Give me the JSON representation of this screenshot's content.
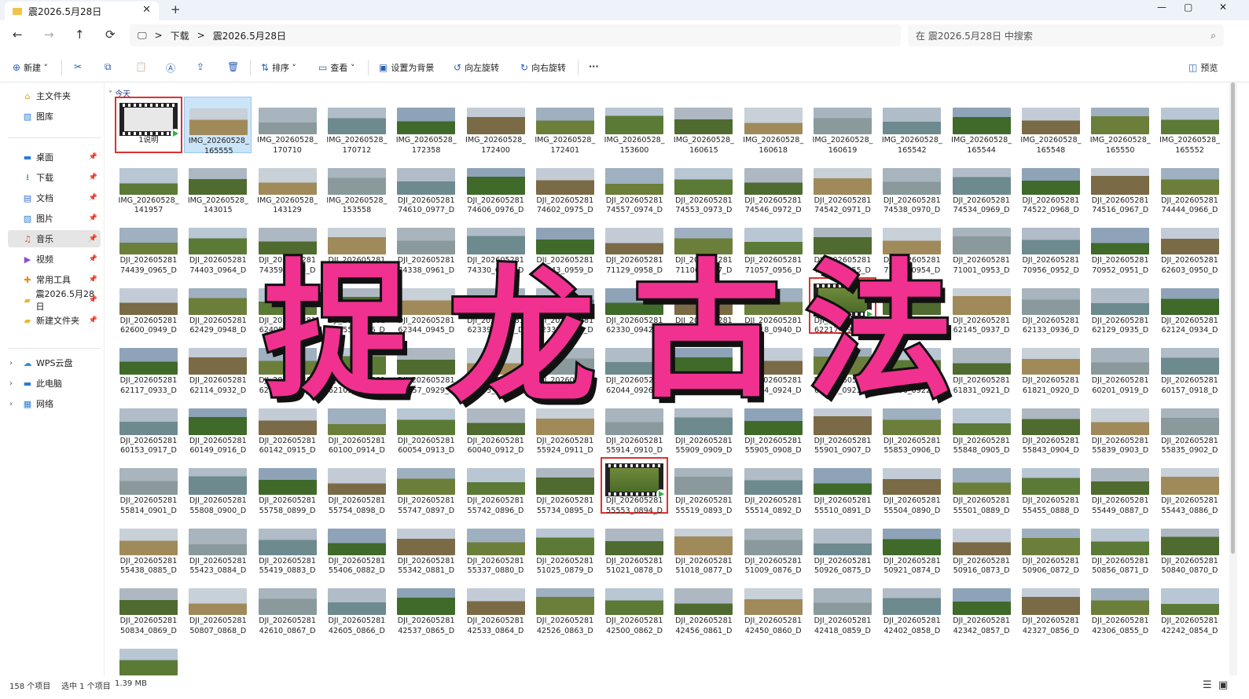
{
  "tab": {
    "title": "震2026.5月28日",
    "close": "✕",
    "new": "+"
  },
  "window": {
    "min": "—",
    "max": "▢",
    "close": "✕"
  },
  "nav": {
    "back": "←",
    "forward": "→",
    "up": "↑",
    "refresh": "⟳",
    "monitor": "🖵",
    "crumb_sep": ">",
    "crumb1": "下载",
    "crumb2": "震2026.5月28日"
  },
  "search": {
    "placeholder": "在 震2026.5月28日 中搜索",
    "icon": "⌕"
  },
  "toolbar": {
    "new": "新建",
    "sort": "排序",
    "view": "查看",
    "setbg": "设置为背景",
    "rotleft": "向左旋转",
    "rotright": "向右旋转",
    "more": "···",
    "preview": "预览",
    "cut": "✂",
    "copy": "⧉",
    "paste": "📋",
    "rename": "Ⓐ",
    "share": "⇪",
    "delete": "🗑"
  },
  "sidebar": {
    "home": "主文件夹",
    "gallery": "图库",
    "quick": [
      {
        "label": "桌面",
        "icon": "▬",
        "color": "#2b7cd3"
      },
      {
        "label": "下载",
        "icon": "⭳",
        "color": "#2b9a4a"
      },
      {
        "label": "文档",
        "icon": "▤",
        "color": "#3a6fcf"
      },
      {
        "label": "图片",
        "icon": "▨",
        "color": "#2f7fd6"
      },
      {
        "label": "音乐",
        "icon": "♫",
        "color": "#e4573b"
      },
      {
        "label": "视频",
        "icon": "▶",
        "color": "#8a4fd0"
      },
      {
        "label": "常用工具",
        "icon": "✚",
        "color": "#e08f1f"
      },
      {
        "label": "震2026.5月28日",
        "icon": "▰",
        "color": "#e8b53a"
      },
      {
        "label": "新建文件夹",
        "icon": "▰",
        "color": "#e8b53a"
      }
    ],
    "pin": "📌",
    "wps": "WPS云盘",
    "pc": "此电脑",
    "net": "网络",
    "chev": "›"
  },
  "group_label": "今天",
  "files": [
    "1说明",
    "IMG_20260528_\n165555",
    "IMG_20260528_\n170710",
    "IMG_20260528_\n170712",
    "IMG_20260528_\n172358",
    "IMG_20260528_\n172400",
    "IMG_20260528_\n172401",
    "IMG_20260528_\n153600",
    "IMG_20260528_\n160615",
    "IMG_20260528_\n160618",
    "IMG_20260528_\n160619",
    "IMG_20260528_\n165542",
    "IMG_20260528_\n165544",
    "IMG_20260528_\n165548",
    "IMG_20260528_\n165550",
    "IMG_20260528_\n165552",
    "IMG_20260528_\n141957",
    "IMG_20260528_\n143015",
    "IMG_20260528_\n143129",
    "IMG_20260528_\n153558",
    "DJI_202605281\n74610_0977_D",
    "DJI_202605281\n74606_0976_D",
    "DJI_202605281\n74602_0975_D",
    "DJI_202605281\n74557_0974_D",
    "DJI_202605281\n74553_0973_D",
    "DJI_202605281\n74546_0972_D",
    "DJI_202605281\n74542_0971_D",
    "DJI_202605281\n74538_0970_D",
    "DJI_202605281\n74534_0969_D",
    "DJI_202605281\n74522_0968_D",
    "DJI_202605281\n74516_0967_D",
    "DJI_202605281\n74444_0966_D",
    "DJI_202605281\n74439_0965_D",
    "DJI_202605281\n74403_0964_D",
    "DJI_202605281\n74359_0963_D",
    "DJI_202605281\n74344_0962_D",
    "DJI_202605281\n74338_0961_D",
    "DJI_202605281\n74330_0960_D",
    "DJI_202605281\n71143_0959_D",
    "DJI_202605281\n71129_0958_D",
    "DJI_202605281\n71106_0957_D",
    "DJI_202605281\n71057_0956_D",
    "DJI_202605281\n71036_0955_D",
    "DJI_202605281\n71005_0954_D",
    "DJI_202605281\n71001_0953_D",
    "DJI_202605281\n70956_0952_D",
    "DJI_202605281\n70952_0951_D",
    "DJI_202605281\n62603_0950_D",
    "DJI_202605281\n62600_0949_D",
    "DJI_202605281\n62429_0948_D",
    "DJI_202605281\n62409_0947_D",
    "DJI_202605281\n62355_0946_D",
    "DJI_202605281\n62344_0945_D",
    "DJI_202605281\n62339_0944_D",
    "DJI_202605281\n62335_0943_D",
    "DJI_202605281\n62330_0942_D",
    "DJI_202605281\n62322_0941_D",
    "DJI_202605281\n62318_0940_D",
    "DJI_202605281\n62217_0939_D",
    "DJI_202605281\n62150_0938_D",
    "DJI_202605281\n62145_0937_D",
    "DJI_202605281\n62133_0936_D",
    "DJI_202605281\n62129_0935_D",
    "DJI_202605281\n62124_0934_D",
    "DJI_202605281\n62117_0933_D",
    "DJI_202605281\n62114_0932_D",
    "DJI_202605281\n62110_0931_D",
    "DJI_202605281\n62105_0930_D",
    "DJI_202605281\n62057_0929_D",
    "DJI_202605281\n62053_0928_D",
    "DJI_202605281\n62048_0927_D",
    "DJI_202605281\n62044_0926_D",
    "DJI_202605281\n61908_0925_D",
    "DJI_202605281\n61904_0924_D",
    "DJI_202605281\n61851_0923_D",
    "DJI_202605281\n61836_0922_D",
    "DJI_202605281\n61831_0921_D",
    "DJI_202605281\n61821_0920_D",
    "DJI_202605281\n60201_0919_D",
    "DJI_202605281\n60157_0918_D",
    "DJI_202605281\n60153_0917_D",
    "DJI_202605281\n60149_0916_D",
    "DJI_202605281\n60142_0915_D",
    "DJI_202605281\n60100_0914_D",
    "DJI_202605281\n60054_0913_D",
    "DJI_202605281\n60040_0912_D",
    "DJI_202605281\n55924_0911_D",
    "DJI_202605281\n55914_0910_D",
    "DJI_202605281\n55909_0909_D",
    "DJI_202605281\n55905_0908_D",
    "DJI_202605281\n55901_0907_D",
    "DJI_202605281\n55853_0906_D",
    "DJI_202605281\n55848_0905_D",
    "DJI_202605281\n55843_0904_D",
    "DJI_202605281\n55839_0903_D",
    "DJI_202605281\n55835_0902_D",
    "DJI_202605281\n55814_0901_D",
    "DJI_202605281\n55808_0900_D",
    "DJI_202605281\n55758_0899_D",
    "DJI_202605281\n55754_0898_D",
    "DJI_202605281\n55747_0897_D",
    "DJI_202605281\n55742_0896_D",
    "DJI_202605281\n55734_0895_D",
    "DJI_202605281\n55553_0894_D",
    "DJI_202605281\n55519_0893_D",
    "DJI_202605281\n55514_0892_D",
    "DJI_202605281\n55510_0891_D",
    "DJI_202605281\n55504_0890_D",
    "DJI_202605281\n55501_0889_D",
    "DJI_202605281\n55455_0888_D",
    "DJI_202605281\n55449_0887_D",
    "DJI_202605281\n55443_0886_D",
    "DJI_202605281\n55438_0885_D",
    "DJI_202605281\n55423_0884_D",
    "DJI_202605281\n55419_0883_D",
    "DJI_202605281\n55406_0882_D",
    "DJI_202605281\n55342_0881_D",
    "DJI_202605281\n55337_0880_D",
    "DJI_202605281\n51025_0879_D",
    "DJI_202605281\n51021_0878_D",
    "DJI_202605281\n51018_0877_D",
    "DJI_202605281\n51009_0876_D",
    "DJI_202605281\n50926_0875_D",
    "DJI_202605281\n50921_0874_D",
    "DJI_202605281\n50916_0873_D",
    "DJI_202605281\n50906_0872_D",
    "DJI_202605281\n50856_0871_D",
    "DJI_202605281\n50840_0870_D",
    "DJI_202605281\n50834_0869_D",
    "DJI_202605281\n50807_0868_D",
    "DJI_202605281\n42610_0867_D",
    "DJI_202605281\n42605_0866_D",
    "DJI_202605281\n42537_0865_D",
    "DJI_202605281\n42533_0864_D",
    "DJI_202605281\n42526_0863_D",
    "DJI_202605281\n42500_0862_D",
    "DJI_202605281\n42456_0861_D",
    "DJI_202605281\n42450_0860_D",
    "DJI_202605281\n42418_0859_D",
    "DJI_202605281\n42402_0858_D",
    "DJI_202605281\n42342_0857_D",
    "DJI_202605281\n42327_0856_D",
    "DJI_202605281\n42306_0855_D",
    "DJI_202605281\n42242_0854_D",
    ""
  ],
  "thumb_palette": [
    {
      "sky": "#aeb8c2",
      "land": "#4f6b2f"
    },
    {
      "sky": "#b9c6d4",
      "land": "#5a7a36"
    },
    {
      "sky": "#9fb0c0",
      "land": "#6b7f3a"
    },
    {
      "sky": "#c3ccd6",
      "land": "#7a6a45"
    },
    {
      "sky": "#8fa3b8",
      "land": "#3f6a2a"
    },
    {
      "sky": "#b0bcc8",
      "land": "#6d8a8f"
    },
    {
      "sky": "#a8b4be",
      "land": "#8a9a9c"
    },
    {
      "sky": "#c8d0d8",
      "land": "#a08a5a"
    }
  ],
  "overlay": "捉龙古法",
  "status": {
    "count": "158 个项目",
    "selected": "选中 1 个项目",
    "size": "1.39 MB",
    "view1": "☰",
    "view2": "▣"
  }
}
